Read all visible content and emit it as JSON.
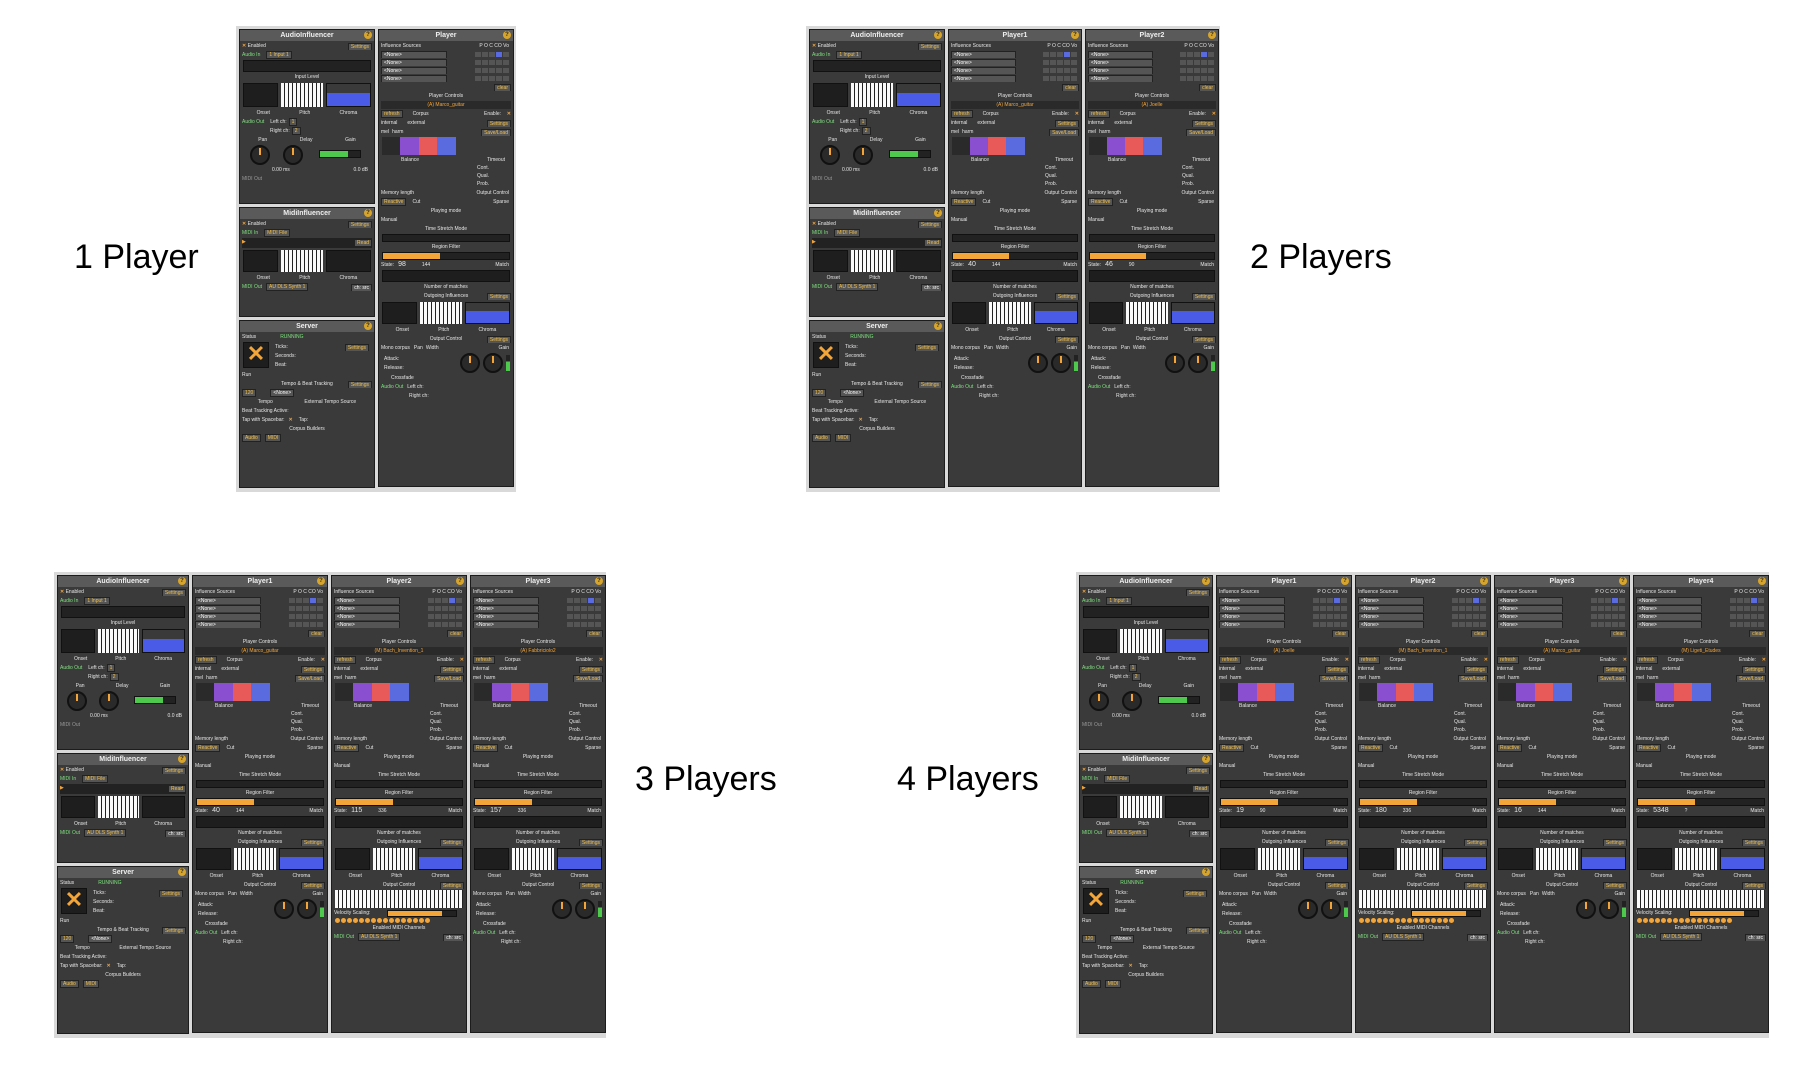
{
  "labels": {
    "one_player": "1 Player",
    "two_players": "2 Players",
    "three_players": "3 Players",
    "four_players": "4 Players"
  },
  "audio_influencer": {
    "title": "AudioInfluencer",
    "enabled": "Enabled",
    "settings": "Settings",
    "audio_in": "Audio In",
    "input_select": "1 Input 1",
    "input_level": "Input Level",
    "onset": "Onset",
    "pitch": "Pitch",
    "chroma": "Chroma",
    "audio_out": "Audio Out",
    "left_ch": "Left ch:",
    "right_ch": "Right ch:",
    "left_val": "1",
    "right_val": "2",
    "pan": "Pan",
    "delay": "Delay",
    "gain": "Gain",
    "delay_val": "0.00 ms",
    "gain_val": "0.0 dB",
    "midi_out": "MIDI Out"
  },
  "midi_influencer": {
    "title": "MidiInfluencer",
    "enabled": "Enabled",
    "settings": "Settings",
    "midi_in": "MIDI In",
    "midi_file": "MIDI File",
    "read": "Read",
    "onset": "Onset",
    "pitch": "Pitch",
    "chroma": "Chroma",
    "midi_out": "MIDI Out",
    "synth": "AU DLS Synth 1",
    "ch_src": "ch: src"
  },
  "server": {
    "title": "Server",
    "status_label": "Status",
    "status": "RUNNING",
    "ticks_label": "Ticks:",
    "seconds_label": "Seconds:",
    "beat_label": "Beat:",
    "settings": "Settings",
    "run": "Run",
    "tempo_beat": "Tempo & Beat Tracking",
    "tempo_val": "120",
    "none": "<None>",
    "tempo": "Tempo",
    "ext_tempo": "External Tempo Source",
    "beat_tracking": "Beat Tracking Active:",
    "tap_space": "Tap with Spacebar:",
    "tap": "Tap:",
    "corpus_builders": "Corpus Builders",
    "audio": "Audio",
    "midi": "MIDI"
  },
  "player_common": {
    "influence_sources": "Influence Sources",
    "cols": "P O C CO Vo",
    "none": "<None>",
    "clear": "clear",
    "player_controls": "Player Controls",
    "refresh": "refresh",
    "corpus": "Corpus",
    "enable": "Enable:",
    "internal": "internal",
    "external": "external",
    "mel": "mel",
    "harm": "harm",
    "save_load": "Save/Load",
    "settings": "Settings",
    "balance": "Balance",
    "timeout": "Timeout",
    "cont": "Cont.",
    "qual": "Qual.",
    "prob": "Prob.",
    "off": "off",
    "memory_length": "Memory length",
    "output_control": "Output Control",
    "reactive": "Reactive",
    "cut": "Cut",
    "sparse": "Sparse",
    "playing_mode": "Playing mode",
    "manual": "Manual",
    "time_stretch": "Time Stretch Mode",
    "region_filter": "Region Filter",
    "state": "State:",
    "match": "Match",
    "number_of_matches": "Number of matches",
    "outgoing": "Outgoing Influences",
    "onset": "Onset",
    "pitch": "Pitch",
    "chroma": "Chroma",
    "mono_corpus": "Mono corpus",
    "pan": "Pan",
    "width": "Width",
    "gain": "Gain",
    "attack": "Attack:",
    "release": "Release:",
    "crossfade": "Crossfade",
    "audio_out": "Audio Out",
    "left_ch": "Left ch:",
    "right_ch": "Right ch:",
    "velocity_scaling": "Velocity Scaling:",
    "enabled_midi": "Enabled MIDI Channels",
    "midi_out": "MIDI Out",
    "synth": "AU DLS Synth 1",
    "ch_src": "ch: src"
  },
  "screens": {
    "one": [
      {
        "title": "Player",
        "corpus": "(A) Marco_guitar",
        "state": "98",
        "max": "144"
      }
    ],
    "two": [
      {
        "title": "Player1",
        "corpus": "(A) Marco_guitar",
        "state": "40",
        "max": "144"
      },
      {
        "title": "Player2",
        "corpus": "(A) Joelle",
        "state": "46",
        "max": "90"
      }
    ],
    "three": [
      {
        "title": "Player1",
        "corpus": "(A) Marco_guitar",
        "state": "40",
        "max": "144"
      },
      {
        "title": "Player2",
        "corpus": "(M) Bach_Invention_1",
        "state": "115",
        "max": "336"
      },
      {
        "title": "Player3",
        "corpus": "(A) Fabbriciolo2",
        "state": "157",
        "max": "336"
      }
    ],
    "four": [
      {
        "title": "Player1",
        "corpus": "(A) Joelle",
        "state": "19",
        "max": "90"
      },
      {
        "title": "Player2",
        "corpus": "(M) Bach_Invention_1",
        "state": "180",
        "max": "336"
      },
      {
        "title": "Player3",
        "corpus": "(A) Marco_guitar",
        "state": "16",
        "max": "144"
      },
      {
        "title": "Player4",
        "corpus": "(M) Ligeti_Etudes",
        "state": "5348",
        "max": "?"
      }
    ]
  }
}
